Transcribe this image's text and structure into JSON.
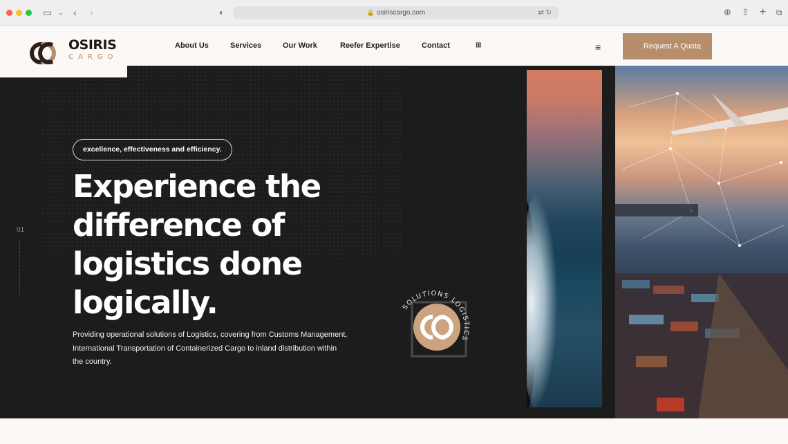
{
  "browser": {
    "url": "osiriscargo.com"
  },
  "header": {
    "logo_text": "OSIRIS",
    "logo_sub": "CARGO",
    "nav": [
      "About Us",
      "Services",
      "Our Work",
      "Reefer Expertise",
      "Contact"
    ],
    "quote_button": "Request A Quote"
  },
  "hero": {
    "slide_number": "01",
    "tagline": "excellence, effectiveness and efficiency.",
    "headline": "Experience the difference of logistics done logically.",
    "description": "Providing operational solutions of Logistics, covering from Customs Management, International Transportation of Containerized Cargo to inland distribution within the country.",
    "badge_text": "SOLUTIONS LOGISTICS"
  },
  "colors": {
    "accent": "#b68e6c",
    "hero_bg": "#1c1c1c",
    "page_bg": "#fbf8f6"
  }
}
